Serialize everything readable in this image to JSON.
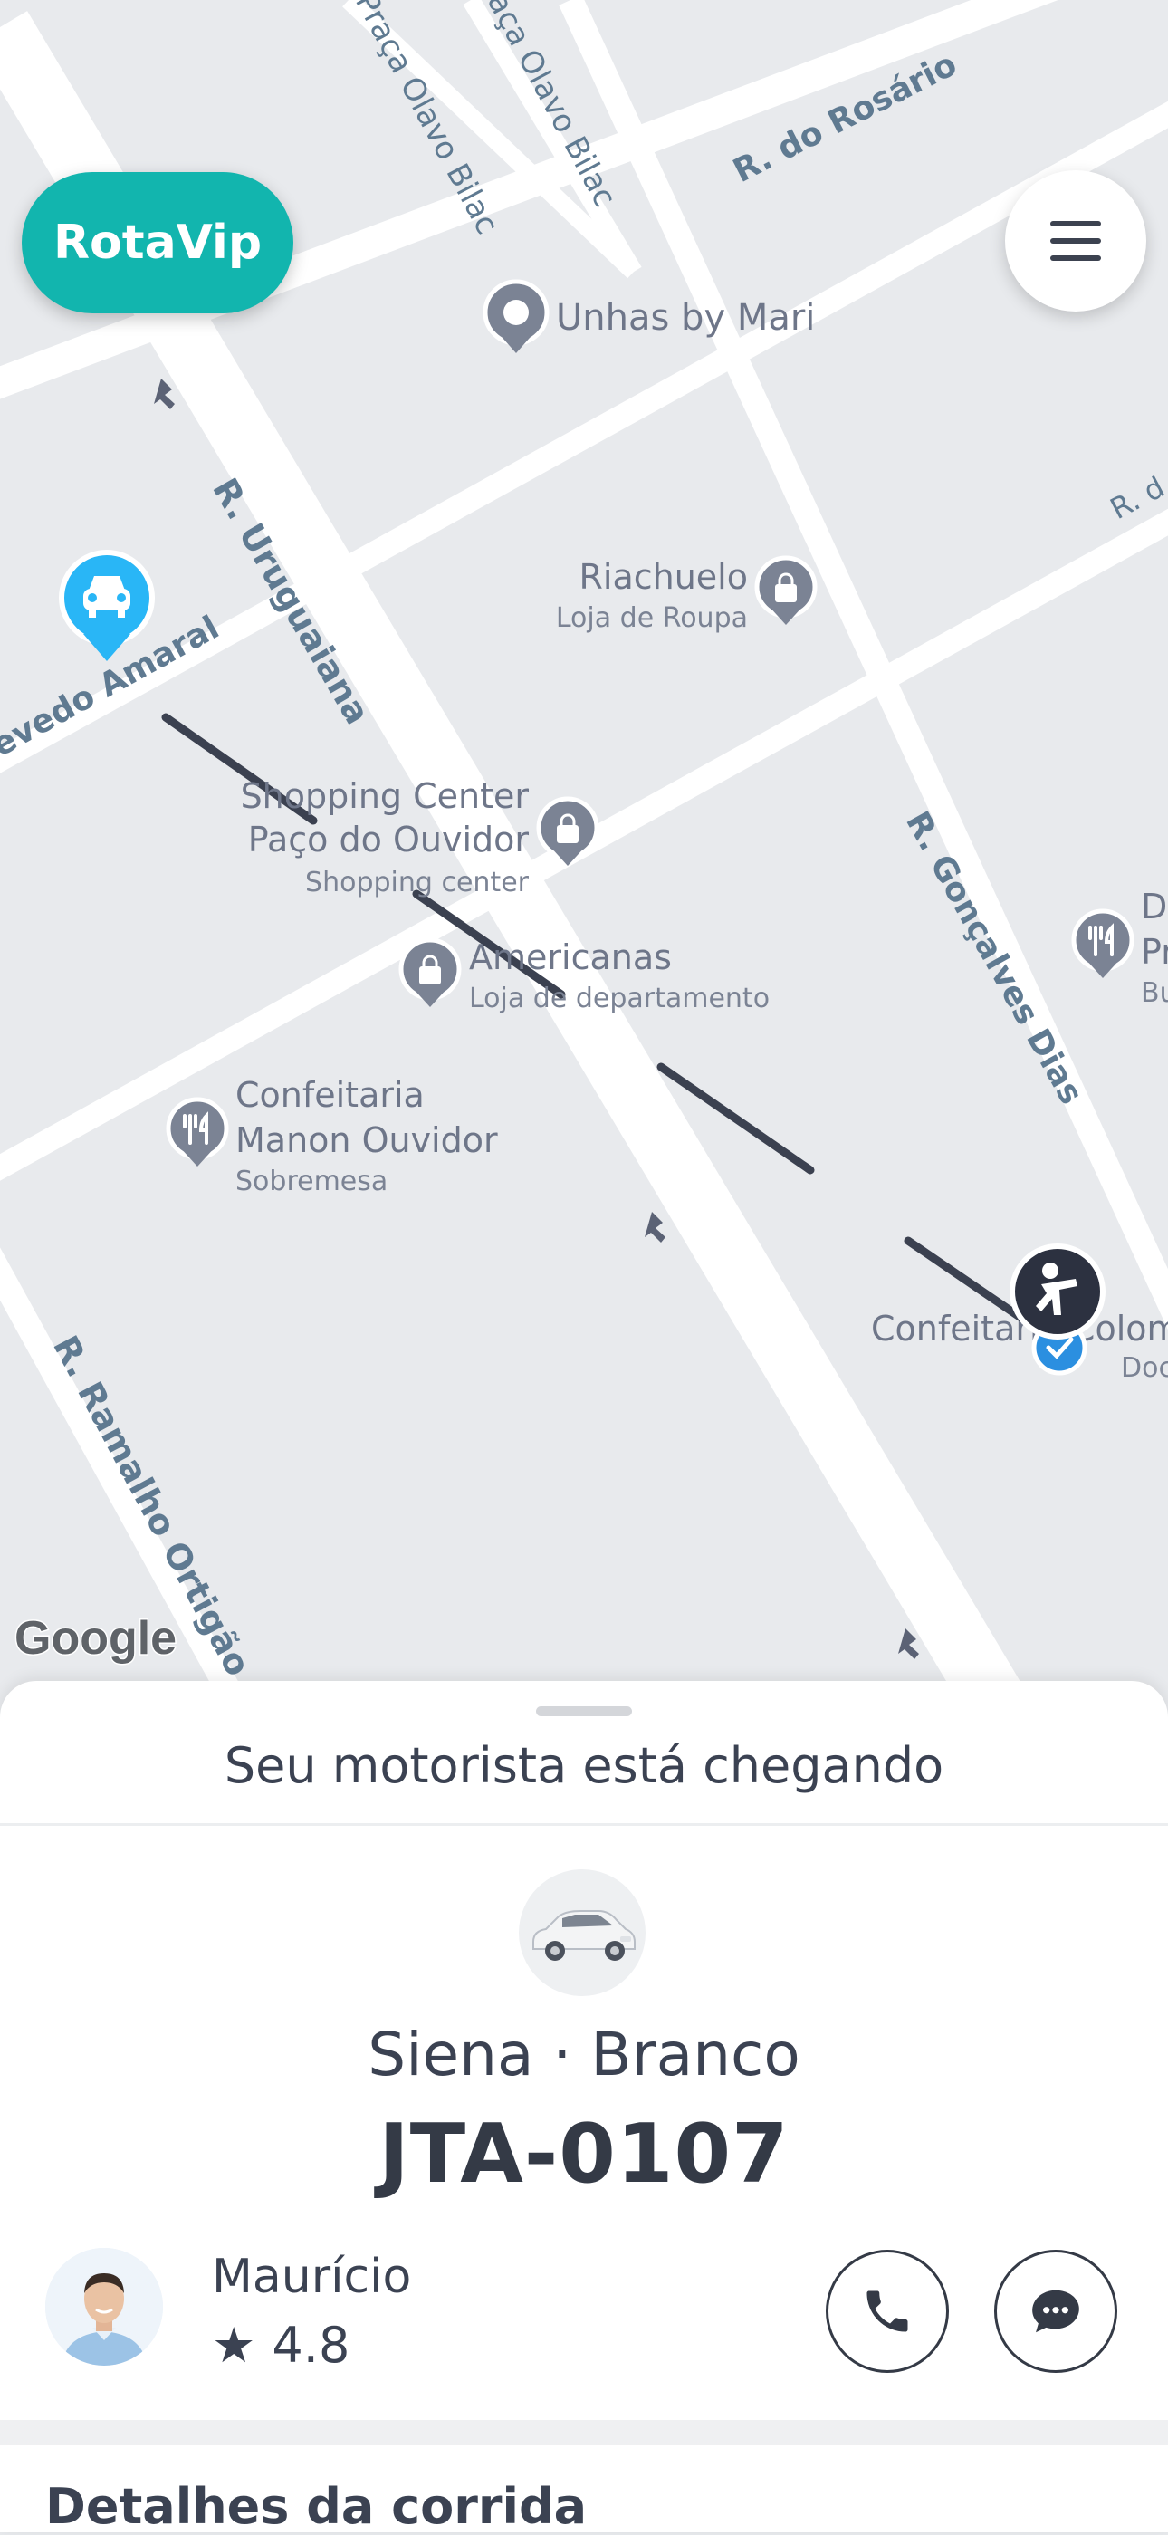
{
  "brand": {
    "label": "RotaVip"
  },
  "map": {
    "streets": {
      "praca_olavo_bilac_1": "Praça Olavo Bilac",
      "praca_olavo_bilac_2": "Praça Olavo Bilac",
      "r_rosario": "R. do Rosário",
      "r_uruguaiana": "R. Uruguaiana",
      "r_goncalves_dias": "R. Gonçalves Dias",
      "r_ramalho_ortigao": "R. Ramalho Ortigão",
      "quevedo_amaral": "evedo Amaral",
      "r_d_edge": "R. d"
    },
    "places": {
      "unhas": {
        "name": "Unhas by Mari"
      },
      "riachuelo": {
        "name": "Riachuelo",
        "category": "Loja de Roupa"
      },
      "shopping": {
        "name_line1": "Shopping Center",
        "name_line2": "Paço do Ouvidor",
        "category": "Shopping center"
      },
      "americanas": {
        "name": "Americanas",
        "category": "Loja de departamento"
      },
      "manon": {
        "name_line1": "Confeitaria",
        "name_line2": "Manon Ouvidor",
        "category": "Sobremesa"
      },
      "colombo": {
        "name": "Confeitaria Colombo",
        "category": "Doc"
      },
      "edge_poi": {
        "line1": "D",
        "line2": "Pr",
        "line3": "Bu"
      }
    },
    "attribution": "Google",
    "icons": [
      "car-pin-icon",
      "pickup-person-icon",
      "location-pin-icon",
      "shopping-bag-icon",
      "restaurant-icon",
      "direction-arrow-icon"
    ]
  },
  "sheet": {
    "status_text": "Seu motorista está chegando",
    "vehicle": {
      "model_color": "Siena · Branco",
      "plate": "JTA-0107"
    },
    "driver": {
      "name": "Maurício",
      "rating": "4.8"
    },
    "details_title": "Detalhes da corrida"
  },
  "colors": {
    "brand": "#12b5ae",
    "map_bg": "#e8eaed",
    "road": "#ffffff",
    "route": "#3b4150",
    "car_pin": "#29b6f6",
    "poi_gray": "#7b8394",
    "street_text": "#5f7a91"
  }
}
